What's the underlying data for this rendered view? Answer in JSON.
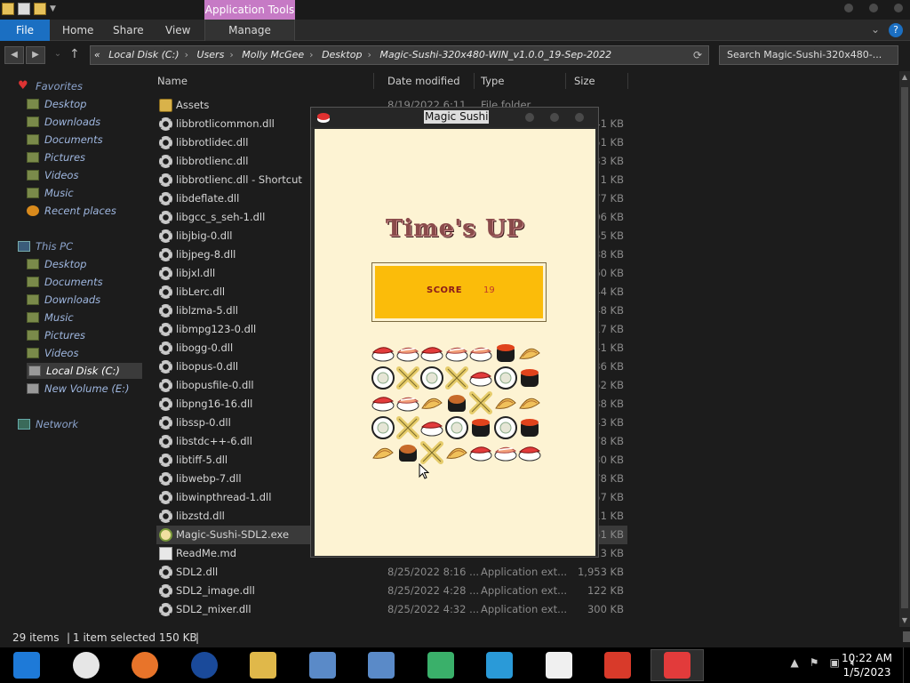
{
  "explorer": {
    "context_tab": "Application Tools",
    "ribbon_tabs": {
      "file": "File",
      "home": "Home",
      "share": "Share",
      "view": "View",
      "manage": "Manage"
    },
    "address": {
      "prefix": "«",
      "crumbs": [
        "Local Disk (C:)",
        "Users",
        "Molly McGee",
        "Desktop",
        "Magic-Sushi-320x480-WIN_v1.0.0_19-Sep-2022"
      ]
    },
    "search": {
      "placeholder": "Search Magic-Sushi-320x480-..."
    },
    "columns": {
      "name": "Name",
      "date": "Date modified",
      "type": "Type",
      "size": "Size"
    },
    "nav": {
      "favorites": "Favorites",
      "fav_items": [
        "Desktop",
        "Downloads",
        "Documents",
        "Pictures",
        "Videos",
        "Music",
        "Recent places"
      ],
      "this_pc": "This PC",
      "pc_items": [
        "Desktop",
        "Documents",
        "Downloads",
        "Music",
        "Pictures",
        "Videos",
        "Local Disk (C:)",
        "New Volume (E:)"
      ],
      "network": "Network"
    },
    "files": [
      {
        "name": "Assets",
        "date": "8/19/2022 6:11 ...",
        "type": "File folder",
        "size": "",
        "icon": "folder"
      },
      {
        "name": "libbrotlicommon.dll",
        "date": "",
        "type": "",
        "size": "41 KB",
        "icon": "gear"
      },
      {
        "name": "libbrotlidec.dll",
        "date": "",
        "type": "",
        "size": "51 KB",
        "icon": "gear"
      },
      {
        "name": "libbrotlienc.dll",
        "date": "",
        "type": "",
        "size": "33 KB",
        "icon": "gear"
      },
      {
        "name": "libbrotlienc.dll - Shortcut",
        "date": "",
        "type": "",
        "size": "1 KB",
        "icon": "gear"
      },
      {
        "name": "libdeflate.dll",
        "date": "",
        "type": "",
        "size": "77 KB",
        "icon": "gear"
      },
      {
        "name": "libgcc_s_seh-1.dll",
        "date": "",
        "type": "",
        "size": "06 KB",
        "icon": "gear"
      },
      {
        "name": "libjbig-0.dll",
        "date": "",
        "type": "",
        "size": "55 KB",
        "icon": "gear"
      },
      {
        "name": "libjpeg-8.dll",
        "date": "",
        "type": "",
        "size": "38 KB",
        "icon": "gear"
      },
      {
        "name": "libjxl.dll",
        "date": "",
        "type": "",
        "size": "60 KB",
        "icon": "gear"
      },
      {
        "name": "libLerc.dll",
        "date": "",
        "type": "",
        "size": "44 KB",
        "icon": "gear"
      },
      {
        "name": "liblzma-5.dll",
        "date": "",
        "type": "",
        "size": "48 KB",
        "icon": "gear"
      },
      {
        "name": "libmpg123-0.dll",
        "date": "",
        "type": "",
        "size": "17 KB",
        "icon": "gear"
      },
      {
        "name": "libogg-0.dll",
        "date": "",
        "type": "",
        "size": "41 KB",
        "icon": "gear"
      },
      {
        "name": "libopus-0.dll",
        "date": "",
        "type": "",
        "size": "36 KB",
        "icon": "gear"
      },
      {
        "name": "libopusfile-0.dll",
        "date": "",
        "type": "",
        "size": "52 KB",
        "icon": "gear"
      },
      {
        "name": "libpng16-16.dll",
        "date": "",
        "type": "",
        "size": "38 KB",
        "icon": "gear"
      },
      {
        "name": "libssp-0.dll",
        "date": "",
        "type": "",
        "size": "43 KB",
        "icon": "gear"
      },
      {
        "name": "libstdc++-6.dll",
        "date": "",
        "type": "",
        "size": "78 KB",
        "icon": "gear"
      },
      {
        "name": "libtiff-5.dll",
        "date": "",
        "type": "",
        "size": "30 KB",
        "icon": "gear"
      },
      {
        "name": "libwebp-7.dll",
        "date": "",
        "type": "",
        "size": "78 KB",
        "icon": "gear"
      },
      {
        "name": "libwinpthread-1.dll",
        "date": "",
        "type": "",
        "size": "57 KB",
        "icon": "gear"
      },
      {
        "name": "libzstd.dll",
        "date": "",
        "type": "",
        "size": "11 KB",
        "icon": "gear"
      },
      {
        "name": "Magic-Sushi-SDL2.exe",
        "date": "",
        "type": "",
        "size": "51 KB",
        "icon": "exe",
        "selected": true
      },
      {
        "name": "ReadMe.md",
        "date": "",
        "type": "",
        "size": "3 KB",
        "icon": "md"
      },
      {
        "name": "SDL2.dll",
        "date": "8/25/2022 8:16 ...",
        "type": "Application ext...",
        "size": "1,953 KB",
        "icon": "gear"
      },
      {
        "name": "SDL2_image.dll",
        "date": "8/25/2022 4:28 ...",
        "type": "Application ext...",
        "size": "122 KB",
        "icon": "gear"
      },
      {
        "name": "SDL2_mixer.dll",
        "date": "8/25/2022 4:32 ...",
        "type": "Application ext...",
        "size": "300 KB",
        "icon": "gear"
      }
    ],
    "status": {
      "items": "29 items",
      "selected": "1 item selected  150 KB"
    }
  },
  "game": {
    "window_title": "Magic Sushi",
    "headline": "Time's UP",
    "score_label": "SCORE",
    "score_value": "19",
    "board": [
      [
        "tuna-nigiri",
        "shrimp-nigiri",
        "tuna-nigiri",
        "shrimp-nigiri",
        "shrimp-nigiri",
        "ikura-gunkan",
        "tamago"
      ],
      [
        "maki-roll",
        "crossed-sticks",
        "maki-roll",
        "crossed-sticks",
        "tuna-nigiri",
        "maki-roll",
        "ikura-gunkan"
      ],
      [
        "tuna-nigiri",
        "shrimp-nigiri",
        "tamago",
        "uni-gunkan",
        "crossed-sticks",
        "tamago",
        "tamago"
      ],
      [
        "maki-roll",
        "crossed-sticks",
        "tuna-nigiri",
        "maki-roll",
        "ikura-gunkan",
        "maki-roll",
        "ikura-gunkan"
      ],
      [
        "tamago",
        "uni-gunkan",
        "crossed-sticks",
        "tamago",
        "tuna-nigiri",
        "shrimp-nigiri",
        "tuna-nigiri"
      ]
    ]
  },
  "taskbar": {
    "apps": [
      "system-icon",
      "chrome-icon",
      "firefox-icon",
      "obama-logo-icon",
      "file-explorer-icon",
      "remote-desktop-icon",
      "remote-desktop-2-icon",
      "users-icon",
      "share-icon",
      "7zip-icon",
      "task-icon",
      "magic-sushi-icon"
    ],
    "time": "10:22 AM",
    "date": "1/5/2023"
  }
}
